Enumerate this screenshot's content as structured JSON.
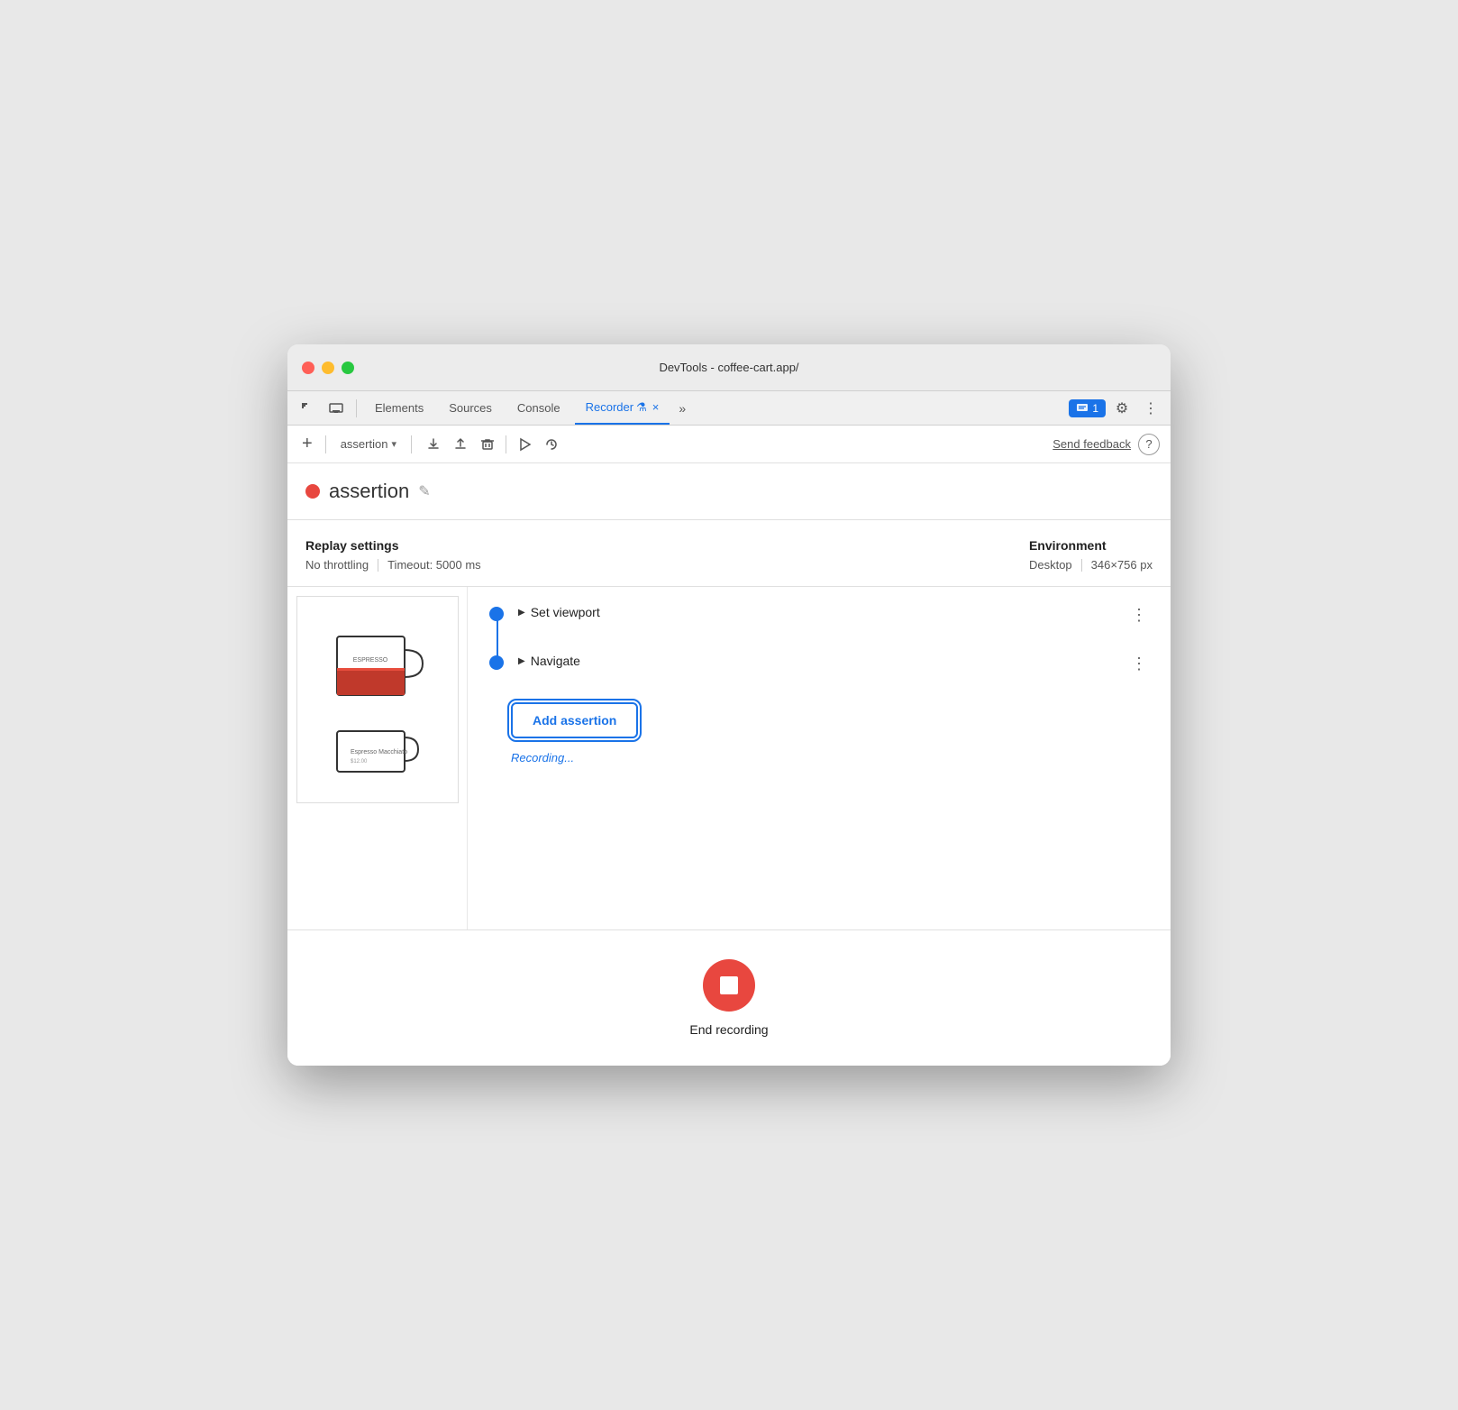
{
  "window": {
    "title": "DevTools - coffee-cart.app/"
  },
  "titlebar": {
    "title": "DevTools - coffee-cart.app/"
  },
  "tabs": {
    "items": [
      {
        "id": "elements",
        "label": "Elements",
        "active": false
      },
      {
        "id": "sources",
        "label": "Sources",
        "active": false
      },
      {
        "id": "console",
        "label": "Console",
        "active": false
      },
      {
        "id": "recorder",
        "label": "Recorder",
        "active": true
      },
      {
        "id": "more",
        "label": "»",
        "active": false
      }
    ],
    "badge_count": "1",
    "close_icon": "×"
  },
  "toolbar": {
    "add_label": "+",
    "recording_name": "assertion",
    "dropdown_arrow": "▾",
    "send_feedback": "Send feedback",
    "help": "?"
  },
  "recording": {
    "dot_color": "#e8473f",
    "name": "assertion",
    "edit_icon": "✎"
  },
  "replay_settings": {
    "title": "Replay settings",
    "throttling": "No throttling",
    "timeout": "Timeout: 5000 ms"
  },
  "environment": {
    "title": "Environment",
    "type": "Desktop",
    "dimensions": "346×756 px"
  },
  "steps": [
    {
      "label": "Set viewport",
      "arrow": "▶"
    },
    {
      "label": "Navigate",
      "arrow": "▶"
    }
  ],
  "add_assertion": {
    "label": "Add assertion"
  },
  "recording_status": {
    "text": "Recording..."
  },
  "end_recording": {
    "label": "End recording"
  }
}
